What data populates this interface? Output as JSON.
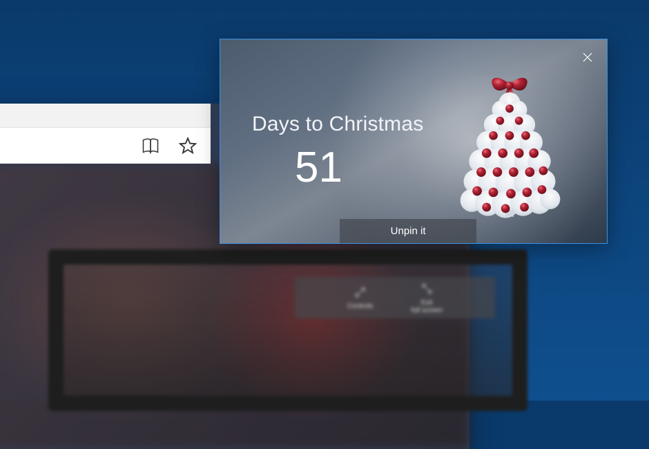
{
  "widget": {
    "title": "Days to Christmas",
    "count": "51",
    "unpin_label": "Unpin it"
  },
  "device_controls": {
    "controls_label": "Controls",
    "exit_label": "Exit\nfull screen"
  },
  "colors": {
    "accent_border": "#3a92e6",
    "ornament": "#9f1d2e"
  }
}
